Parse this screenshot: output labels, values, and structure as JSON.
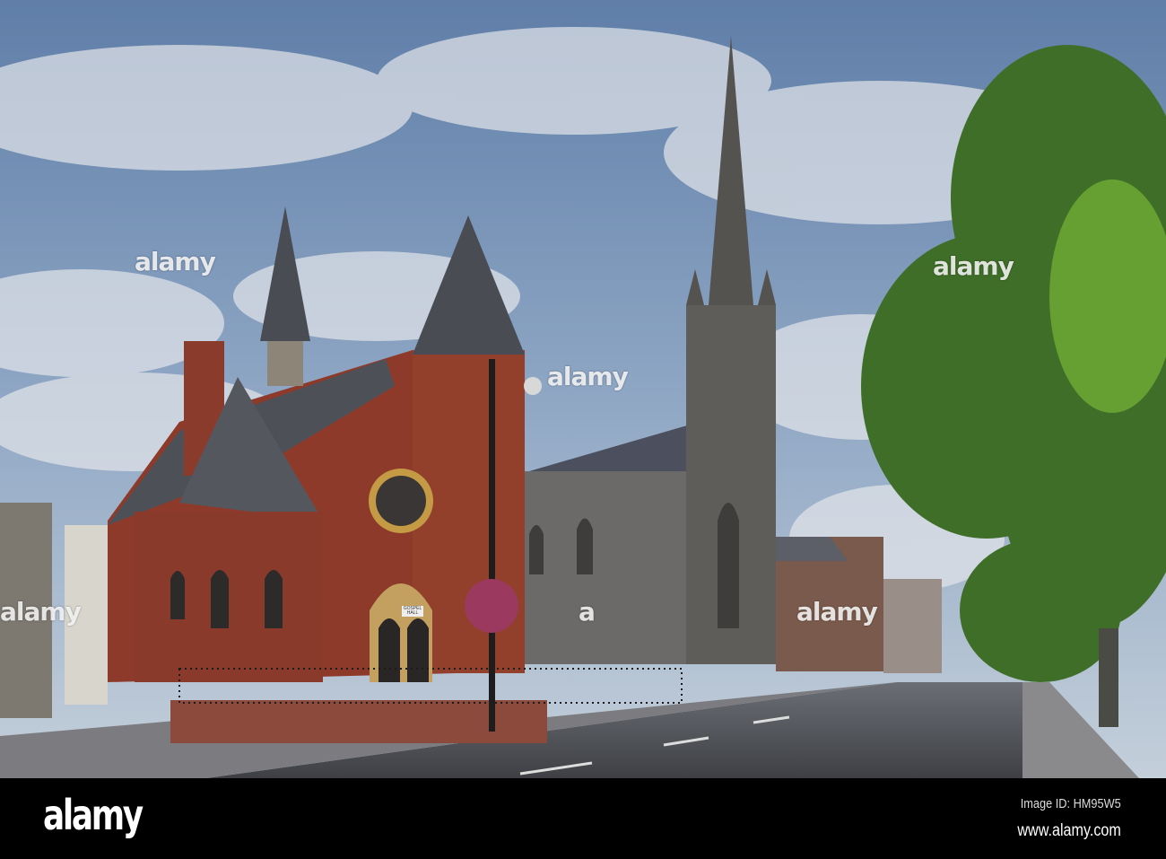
{
  "watermark": {
    "text": "alamy",
    "letter": "a"
  },
  "signs": {
    "hall": "GOSPEL HALL"
  },
  "footer": {
    "logo": "alamy",
    "image_id": "Image ID: HM95W5",
    "website": "www.alamy.com"
  }
}
